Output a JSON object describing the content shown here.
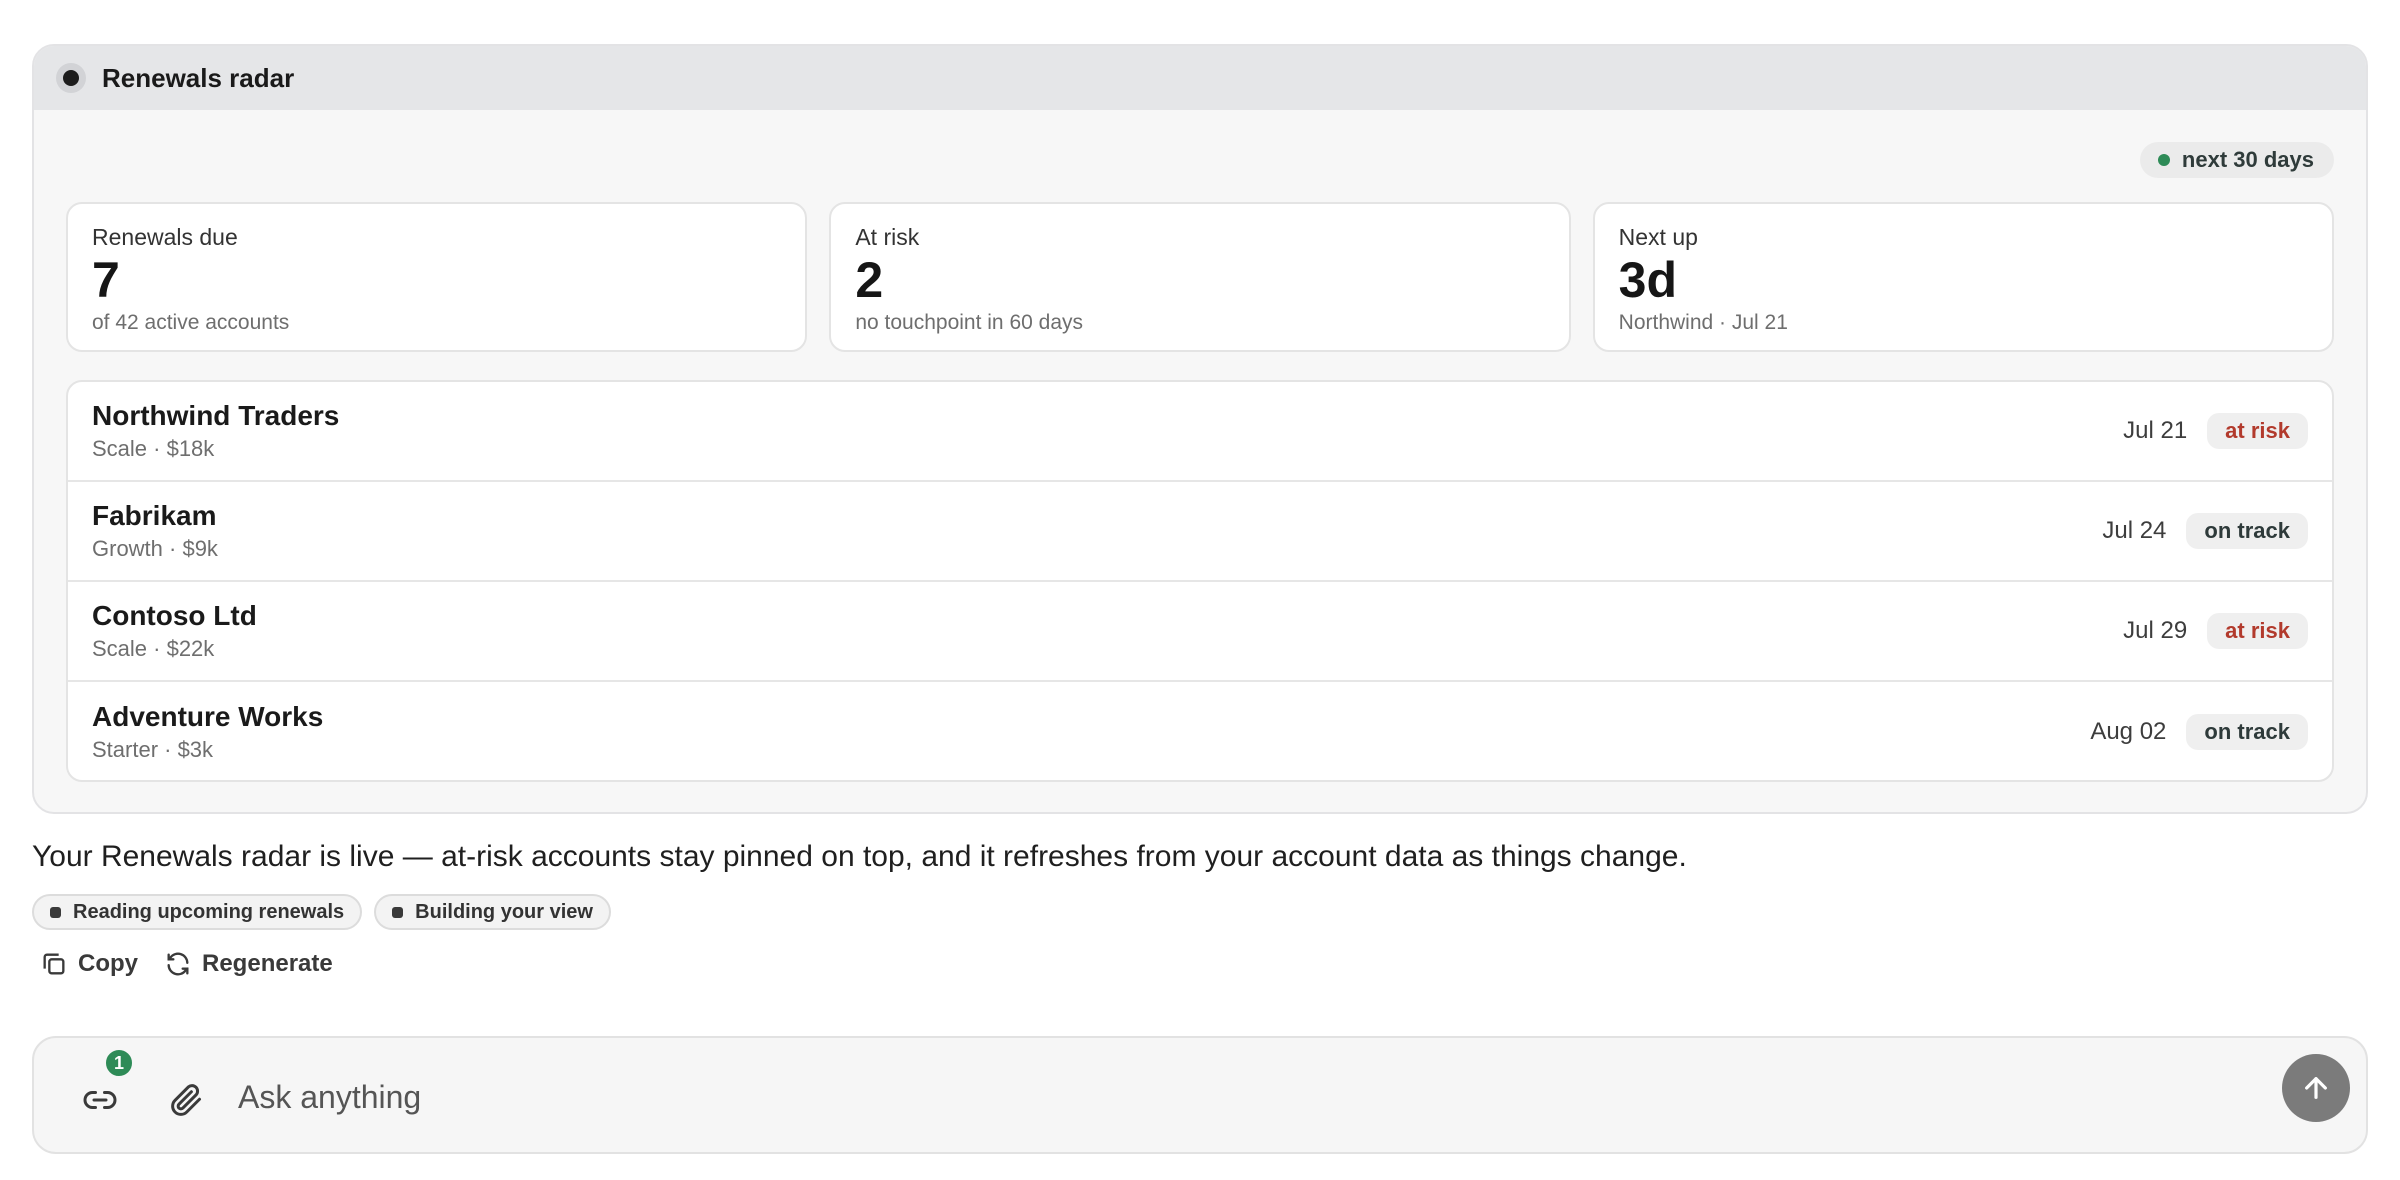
{
  "widget": {
    "title": "Renewals radar",
    "range_label": "next 30 days",
    "stats": [
      {
        "label": "Renewals due",
        "value": "7",
        "sub": "of 42 active accounts"
      },
      {
        "label": "At risk",
        "value": "2",
        "sub": "no touchpoint in 60 days"
      },
      {
        "label": "Next up",
        "value": "3d",
        "sub": "Northwind · Jul 21"
      }
    ],
    "accounts": [
      {
        "name": "Northwind Traders",
        "meta": "Scale · $18k",
        "date": "Jul 21",
        "status": "at risk"
      },
      {
        "name": "Fabrikam",
        "meta": "Growth · $9k",
        "date": "Jul 24",
        "status": "on track"
      },
      {
        "name": "Contoso Ltd",
        "meta": "Scale · $22k",
        "date": "Jul 29",
        "status": "at risk"
      },
      {
        "name": "Adventure Works",
        "meta": "Starter · $3k",
        "date": "Aug 02",
        "status": "on track"
      }
    ]
  },
  "message": {
    "text": "Your Renewals radar is live — at-risk accounts stay pinned on top, and it refreshes from your account data as things change.",
    "steps": [
      "Reading upcoming renewals",
      "Building your view"
    ],
    "copy_label": "Copy",
    "regenerate_label": "Regenerate"
  },
  "composer": {
    "placeholder": "Ask anything",
    "link_count": "1"
  },
  "colors": {
    "accent_green": "#2e8b57",
    "risk_red": "#b23a2c"
  }
}
